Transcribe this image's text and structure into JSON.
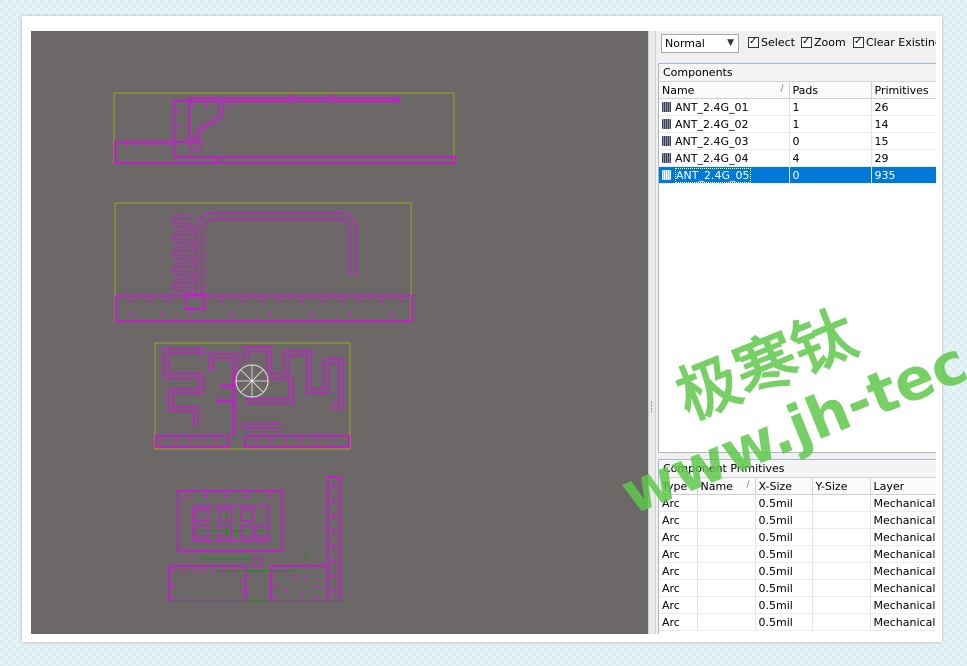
{
  "toolbar": {
    "mode": "Normal",
    "select_label": "Select",
    "zoom_label": "Zoom",
    "clear_label": "Clear Existing"
  },
  "components": {
    "title": "Components",
    "headers": [
      "Name",
      "Pads",
      "Primitives"
    ],
    "rows": [
      {
        "name": "ANT_2.4G_01",
        "pads": "1",
        "primitives": "26"
      },
      {
        "name": "ANT_2.4G_02",
        "pads": "1",
        "primitives": "14"
      },
      {
        "name": "ANT_2.4G_03",
        "pads": "0",
        "primitives": "15"
      },
      {
        "name": "ANT_2.4G_04",
        "pads": "4",
        "primitives": "29"
      },
      {
        "name": "ANT_2.4G_05",
        "pads": "0",
        "primitives": "935"
      }
    ],
    "selected_index": 4
  },
  "primitives": {
    "title": "Component Primitives",
    "headers": [
      "Type",
      "Name",
      "X-Size",
      "Y-Size",
      "Layer"
    ],
    "rows": [
      {
        "type": "Arc",
        "name": "",
        "xsize": "0.5mil",
        "ysize": "",
        "layer": "Mechanical"
      },
      {
        "type": "Arc",
        "name": "",
        "xsize": "0.5mil",
        "ysize": "",
        "layer": "Mechanical"
      },
      {
        "type": "Arc",
        "name": "",
        "xsize": "0.5mil",
        "ysize": "",
        "layer": "Mechanical"
      },
      {
        "type": "Arc",
        "name": "",
        "xsize": "0.5mil",
        "ysize": "",
        "layer": "Mechanical"
      },
      {
        "type": "Arc",
        "name": "",
        "xsize": "0.5mil",
        "ysize": "",
        "layer": "Mechanical"
      },
      {
        "type": "Arc",
        "name": "",
        "xsize": "0.5mil",
        "ysize": "",
        "layer": "Mechanical"
      },
      {
        "type": "Arc",
        "name": "",
        "xsize": "0.5mil",
        "ysize": "",
        "layer": "Mechanical"
      },
      {
        "type": "Arc",
        "name": "",
        "xsize": "0.5mil",
        "ysize": "",
        "layer": "Mechanical"
      }
    ]
  },
  "watermark": {
    "line1": "极寒钛",
    "line2": "www.jh-tec.cn"
  },
  "colors": {
    "canvas": "#6d6868",
    "trace": "#c020c8",
    "outline": "#9aa51a",
    "silk": "#1f8a1f",
    "selection": "#0078d7",
    "watermark": "#5ec84a"
  }
}
